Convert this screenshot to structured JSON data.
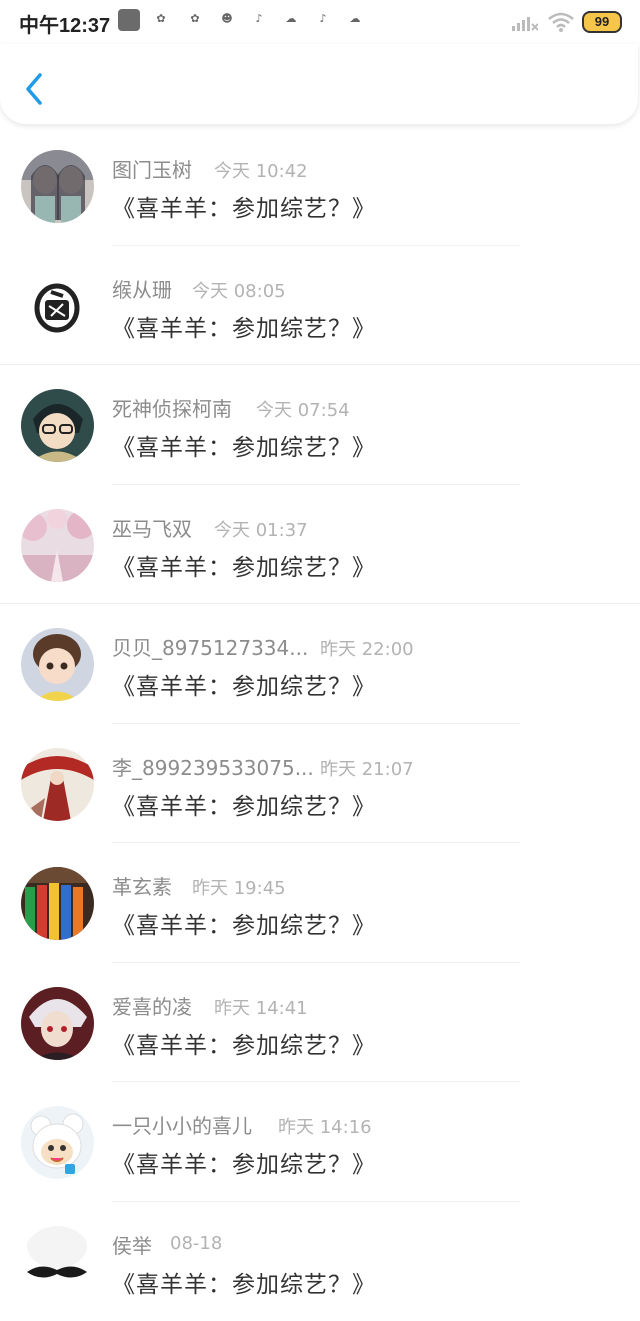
{
  "status_bar": {
    "time": "中午12:37",
    "battery": "99",
    "icons": [
      "app-icon",
      "notification-icon",
      "notification-icon",
      "notification-icon",
      "notification-icon",
      "notification-icon",
      "notification-icon",
      "notification-icon",
      "signal-icon",
      "wifi-icon",
      "battery-icon"
    ]
  },
  "navbar": {
    "back_icon": "chevron-left-icon",
    "accent": "#1e9be9"
  },
  "messages": [
    {
      "name": "图门玉树",
      "time": "今天 10:42",
      "text": "《喜羊羊：参加综艺？》"
    },
    {
      "name": "缑从珊",
      "time": "今天 08:05",
      "text": "《喜羊羊：参加综艺？》"
    },
    {
      "name": "死神侦探柯南",
      "time": "今天 07:54",
      "text": "《喜羊羊：参加综艺？》"
    },
    {
      "name": "巫马飞双",
      "time": "今天 01:37",
      "text": "《喜羊羊：参加综艺？》"
    },
    {
      "name": "贝贝_8975127334...",
      "time": "昨天 22:00",
      "text": "《喜羊羊：参加综艺？》"
    },
    {
      "name": "李_899239533075...",
      "time": "昨天 21:07",
      "text": "《喜羊羊：参加综艺？》"
    },
    {
      "name": "革玄素",
      "time": "昨天 19:45",
      "text": "《喜羊羊：参加综艺？》"
    },
    {
      "name": "爱喜的凌",
      "time": "昨天 14:41",
      "text": "《喜羊羊：参加综艺？》"
    },
    {
      "name": "一只小小的喜儿",
      "time": "昨天 14:16",
      "text": "《喜羊羊：参加综艺？》"
    },
    {
      "name": "侯举",
      "time": "08-18",
      "text": "《喜羊羊：参加综艺？》"
    }
  ]
}
